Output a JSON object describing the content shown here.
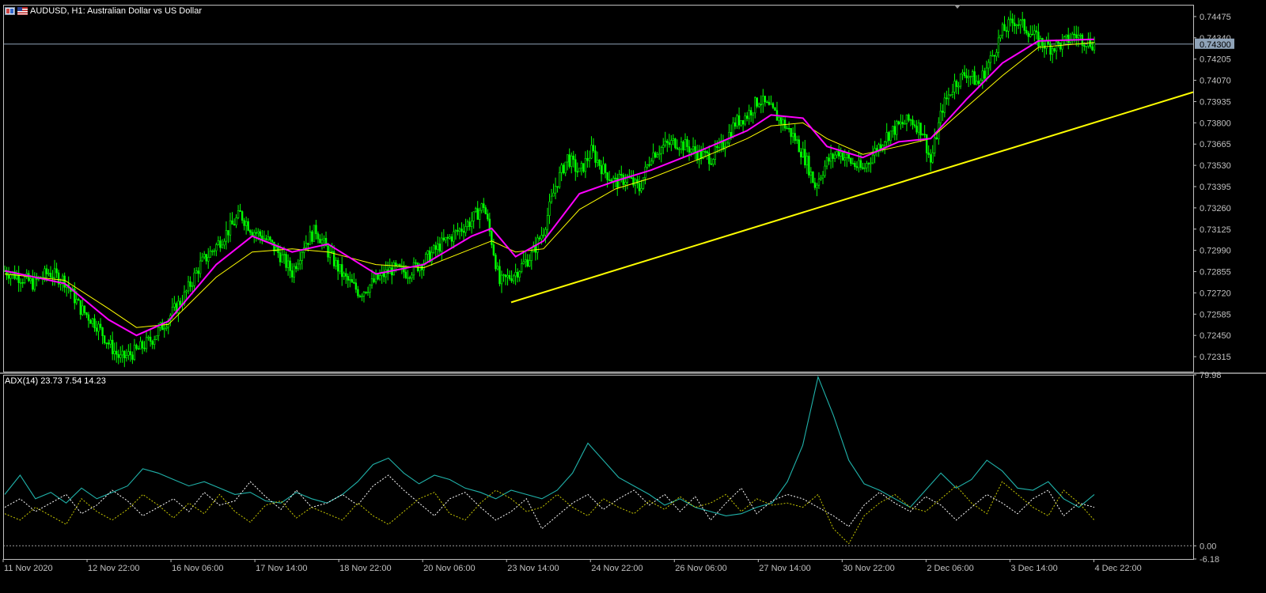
{
  "window": {
    "symbol": "AUDUSD",
    "timeframe": "H1",
    "description": "Australian Dollar vs US Dollar",
    "title_text": "AUDUSD, H1:  Australian Dollar vs US Dollar",
    "background": "#000000",
    "axis_color": "#c0c0c0"
  },
  "price_scale": {
    "labels": [
      "0.74475",
      "0.74340",
      "0.74205",
      "0.74070",
      "0.73935",
      "0.73800",
      "0.73665",
      "0.73530",
      "0.73395",
      "0.73260",
      "0.73125",
      "0.72990",
      "0.72855",
      "0.72720",
      "0.72585",
      "0.72450",
      "0.72315"
    ],
    "current_price_label": "0.74300",
    "range": [
      0.7222,
      0.7455
    ]
  },
  "time_axis": {
    "labels": [
      "11 Nov 2020",
      "12 Nov 22:00",
      "16 Nov 06:00",
      "17 Nov 14:00",
      "18 Nov 22:00",
      "20 Nov 06:00",
      "23 Nov 14:00",
      "24 Nov 22:00",
      "26 Nov 06:00",
      "27 Nov 14:00",
      "30 Nov 22:00",
      "2 Dec 06:00",
      "3 Dec 14:00",
      "4 Dec 22:00"
    ]
  },
  "indicator": {
    "title_text": "ADX(14) 23.73 7.54 14.23",
    "name": "ADX(14)",
    "values": [
      "23.73",
      "7.54",
      "14.23"
    ],
    "scale_labels": [
      "79.98",
      "0.00",
      "-6.18"
    ],
    "range": [
      -6.18,
      79.98
    ]
  },
  "colors": {
    "candle": "#00ff00",
    "ma_fast": "#ff00ff",
    "ma_slow": "#ffff00",
    "trendline": "#ffff00",
    "adx": "#20b2aa",
    "plus_di": "#ffffff",
    "minus_di": "#c8c800",
    "price_line": "#8fa3b8"
  },
  "chart_data": [
    {
      "type": "candlestick",
      "title": "AUDUSD, H1:  Australian Dollar vs US Dollar",
      "x_start_label": "11 Nov 2020",
      "x_end_label": "4 Dec 22:00",
      "close_path": [
        [
          0,
          0.7286
        ],
        [
          8,
          0.7282
        ],
        [
          14,
          0.7278
        ],
        [
          22,
          0.7285
        ],
        [
          30,
          0.728
        ],
        [
          38,
          0.7262
        ],
        [
          46,
          0.7252
        ],
        [
          52,
          0.724
        ],
        [
          58,
          0.723
        ],
        [
          66,
          0.7235
        ],
        [
          74,
          0.7243
        ],
        [
          82,
          0.7256
        ],
        [
          90,
          0.727
        ],
        [
          98,
          0.729
        ],
        [
          106,
          0.7302
        ],
        [
          114,
          0.7315
        ],
        [
          118,
          0.7322
        ],
        [
          124,
          0.7312
        ],
        [
          132,
          0.7305
        ],
        [
          138,
          0.7296
        ],
        [
          144,
          0.7285
        ],
        [
          150,
          0.7303
        ],
        [
          156,
          0.7312
        ],
        [
          162,
          0.7298
        ],
        [
          170,
          0.7282
        ],
        [
          178,
          0.7272
        ],
        [
          186,
          0.728
        ],
        [
          194,
          0.7287
        ],
        [
          202,
          0.7285
        ],
        [
          210,
          0.7292
        ],
        [
          218,
          0.7302
        ],
        [
          226,
          0.731
        ],
        [
          234,
          0.7318
        ],
        [
          240,
          0.7328
        ],
        [
          244,
          0.7305
        ],
        [
          248,
          0.7278
        ],
        [
          256,
          0.7285
        ],
        [
          264,
          0.7296
        ],
        [
          270,
          0.7312
        ],
        [
          276,
          0.734
        ],
        [
          282,
          0.7358
        ],
        [
          288,
          0.7348
        ],
        [
          294,
          0.7362
        ],
        [
          300,
          0.735
        ],
        [
          306,
          0.7342
        ],
        [
          312,
          0.7345
        ],
        [
          318,
          0.7338
        ],
        [
          324,
          0.736
        ],
        [
          330,
          0.7365
        ],
        [
          336,
          0.7368
        ],
        [
          342,
          0.7365
        ],
        [
          348,
          0.736
        ],
        [
          354,
          0.7358
        ],
        [
          360,
          0.7366
        ],
        [
          366,
          0.738
        ],
        [
          372,
          0.7385
        ],
        [
          378,
          0.7395
        ],
        [
          384,
          0.7388
        ],
        [
          390,
          0.738
        ],
        [
          396,
          0.737
        ],
        [
          402,
          0.7355
        ],
        [
          406,
          0.734
        ],
        [
          412,
          0.7355
        ],
        [
          418,
          0.7362
        ],
        [
          424,
          0.7355
        ],
        [
          430,
          0.735
        ],
        [
          436,
          0.7362
        ],
        [
          442,
          0.7372
        ],
        [
          448,
          0.7378
        ],
        [
          454,
          0.7382
        ],
        [
          460,
          0.7375
        ],
        [
          464,
          0.7355
        ],
        [
          470,
          0.739
        ],
        [
          476,
          0.7405
        ],
        [
          482,
          0.7412
        ],
        [
          488,
          0.7405
        ],
        [
          494,
          0.742
        ],
        [
          500,
          0.7438
        ],
        [
          506,
          0.7445
        ],
        [
          512,
          0.744
        ],
        [
          518,
          0.7432
        ],
        [
          524,
          0.7428
        ],
        [
          530,
          0.743
        ],
        [
          536,
          0.7436
        ],
        [
          542,
          0.7432
        ],
        [
          546,
          0.743
        ]
      ],
      "ma_fast_path": [
        [
          0,
          0.7286
        ],
        [
          30,
          0.7278
        ],
        [
          52,
          0.7255
        ],
        [
          66,
          0.7245
        ],
        [
          82,
          0.7254
        ],
        [
          106,
          0.729
        ],
        [
          124,
          0.7308
        ],
        [
          144,
          0.7298
        ],
        [
          162,
          0.7303
        ],
        [
          186,
          0.7284
        ],
        [
          210,
          0.729
        ],
        [
          234,
          0.7308
        ],
        [
          244,
          0.7313
        ],
        [
          256,
          0.7295
        ],
        [
          270,
          0.7305
        ],
        [
          288,
          0.7335
        ],
        [
          306,
          0.7343
        ],
        [
          324,
          0.735
        ],
        [
          348,
          0.7362
        ],
        [
          372,
          0.7375
        ],
        [
          384,
          0.7385
        ],
        [
          400,
          0.7383
        ],
        [
          412,
          0.7365
        ],
        [
          430,
          0.7358
        ],
        [
          448,
          0.7368
        ],
        [
          464,
          0.737
        ],
        [
          482,
          0.7395
        ],
        [
          500,
          0.7418
        ],
        [
          518,
          0.7432
        ],
        [
          546,
          0.7433
        ]
      ],
      "ma_slow_path": [
        [
          0,
          0.7284
        ],
        [
          30,
          0.728
        ],
        [
          52,
          0.7262
        ],
        [
          66,
          0.725
        ],
        [
          82,
          0.7252
        ],
        [
          106,
          0.7282
        ],
        [
          124,
          0.7298
        ],
        [
          144,
          0.73
        ],
        [
          162,
          0.7298
        ],
        [
          186,
          0.729
        ],
        [
          210,
          0.7288
        ],
        [
          234,
          0.73
        ],
        [
          244,
          0.7305
        ],
        [
          256,
          0.7298
        ],
        [
          270,
          0.73
        ],
        [
          288,
          0.7325
        ],
        [
          306,
          0.7338
        ],
        [
          324,
          0.7345
        ],
        [
          348,
          0.7357
        ],
        [
          372,
          0.737
        ],
        [
          384,
          0.7378
        ],
        [
          400,
          0.738
        ],
        [
          412,
          0.737
        ],
        [
          430,
          0.736
        ],
        [
          448,
          0.7365
        ],
        [
          464,
          0.737
        ],
        [
          482,
          0.739
        ],
        [
          500,
          0.741
        ],
        [
          518,
          0.7428
        ],
        [
          546,
          0.7431
        ]
      ],
      "trendline": [
        [
          232,
          0.7266
        ],
        [
          546,
          0.7397
        ]
      ]
    },
    {
      "type": "line",
      "title": "ADX(14) 23.73 7.54 14.23",
      "ylim": [
        -6.18,
        79.98
      ],
      "series": [
        {
          "name": "ADX",
          "values": [
            24,
            33,
            22,
            25,
            20,
            27,
            22,
            25,
            28,
            36,
            34,
            31,
            28,
            30,
            27,
            24,
            25,
            21,
            20,
            25,
            22,
            20,
            24,
            30,
            38,
            41,
            34,
            29,
            33,
            31,
            27,
            25,
            22,
            26,
            24,
            22,
            26,
            34,
            48,
            40,
            32,
            28,
            24,
            19,
            22,
            18,
            16,
            14,
            15,
            18,
            20,
            30,
            47,
            79,
            61,
            40,
            29,
            26,
            22,
            18,
            26,
            34,
            27,
            31,
            40,
            35,
            27,
            26,
            30,
            22,
            18,
            24
          ]
        },
        {
          "name": "+DI",
          "values": [
            18,
            22,
            16,
            20,
            24,
            15,
            19,
            26,
            21,
            14,
            18,
            22,
            16,
            25,
            19,
            21,
            30,
            23,
            17,
            26,
            18,
            20,
            24,
            19,
            28,
            33,
            26,
            20,
            14,
            22,
            25,
            18,
            12,
            16,
            22,
            8,
            14,
            20,
            24,
            17,
            22,
            26,
            19,
            24,
            16,
            23,
            12,
            20,
            27,
            15,
            21,
            24,
            22,
            18,
            14,
            9,
            19,
            25,
            20,
            16,
            23,
            19,
            12,
            18,
            24,
            20,
            15,
            22,
            26,
            14,
            20,
            18
          ]
        },
        {
          "name": "-DI",
          "values": [
            15,
            12,
            18,
            14,
            10,
            22,
            16,
            12,
            17,
            24,
            19,
            13,
            20,
            15,
            24,
            16,
            11,
            19,
            21,
            13,
            18,
            15,
            12,
            20,
            14,
            10,
            16,
            22,
            25,
            15,
            12,
            20,
            26,
            22,
            16,
            18,
            24,
            18,
            14,
            22,
            18,
            15,
            21,
            17,
            23,
            18,
            20,
            24,
            16,
            22,
            19,
            20,
            18,
            24,
            8,
            1,
            14,
            20,
            24,
            18,
            16,
            22,
            28,
            20,
            15,
            30,
            24,
            18,
            14,
            26,
            20,
            12
          ]
        }
      ]
    }
  ]
}
